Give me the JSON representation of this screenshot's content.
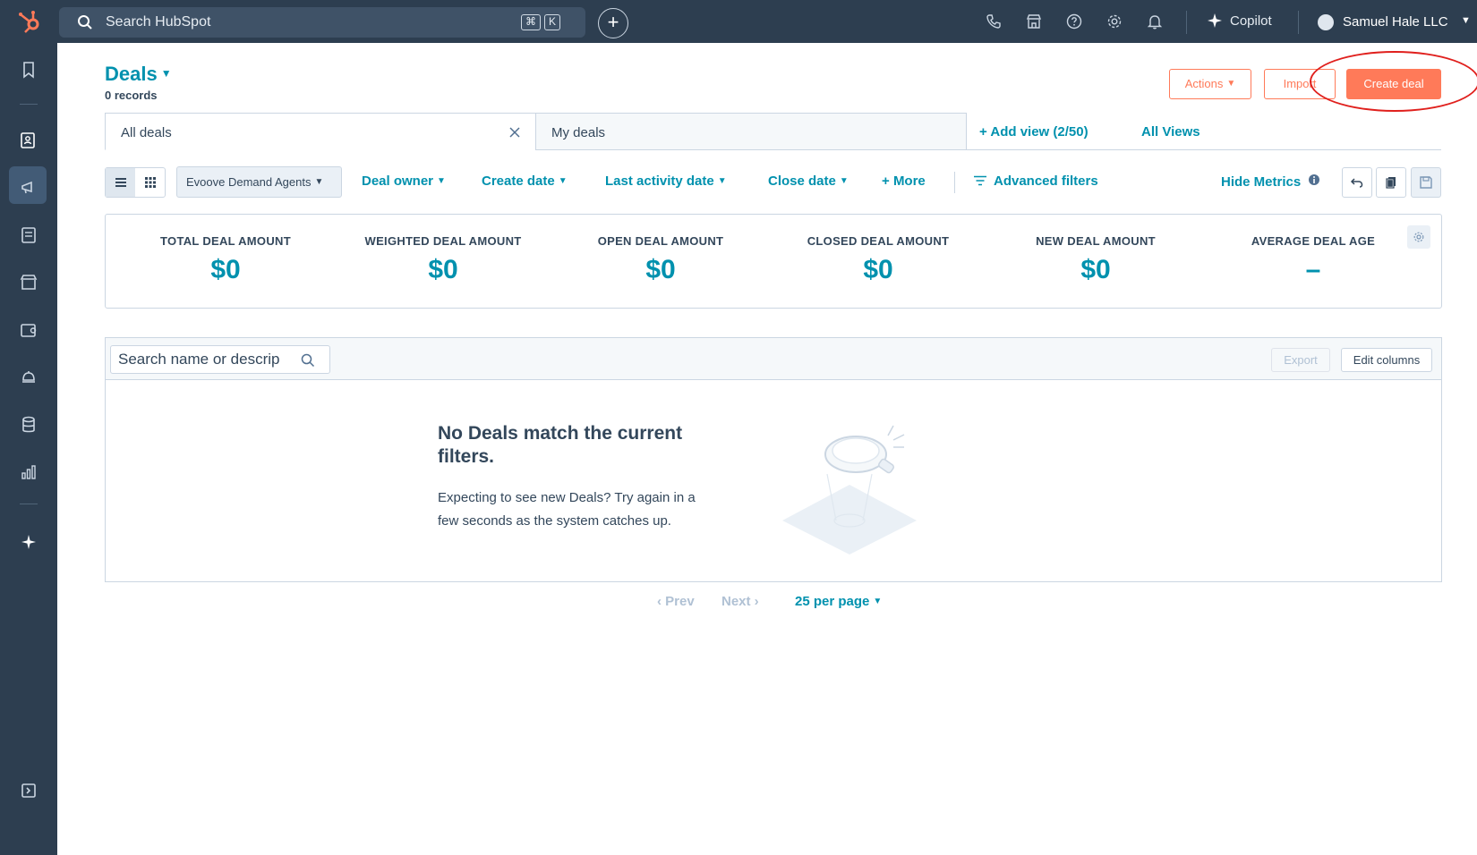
{
  "topbar": {
    "search_label": "Search HubSpot",
    "kbd_cmd": "⌘",
    "kbd_k": "K",
    "copilot_label": "Copilot",
    "account_name": "Samuel Hale LLC"
  },
  "header": {
    "title": "Deals",
    "records": "0 records",
    "actions_label": "Actions",
    "import_label": "Import",
    "create_label": "Create deal"
  },
  "tabs": {
    "all_deals": "All deals",
    "my_deals": "My deals",
    "add_view": "Add view (2/50)",
    "all_views": "All Views"
  },
  "filters": {
    "pipeline": "Evoove Demand Agents",
    "deal_owner": "Deal owner",
    "create_date": "Create date",
    "last_activity": "Last activity date",
    "close_date": "Close date",
    "more": "More",
    "advanced": "Advanced filters",
    "hide_metrics": "Hide Metrics"
  },
  "metrics": [
    {
      "label": "TOTAL DEAL AMOUNT",
      "value": "$0"
    },
    {
      "label": "WEIGHTED DEAL AMOUNT",
      "value": "$0"
    },
    {
      "label": "OPEN DEAL AMOUNT",
      "value": "$0"
    },
    {
      "label": "CLOSED DEAL AMOUNT",
      "value": "$0"
    },
    {
      "label": "NEW DEAL AMOUNT",
      "value": "$0"
    },
    {
      "label": "AVERAGE DEAL AGE",
      "value": "–"
    }
  ],
  "table": {
    "search_placeholder": "Search name or descrip",
    "export_label": "Export",
    "edit_columns_label": "Edit columns",
    "empty_title": "No Deals match the current filters.",
    "empty_text": "Expecting to see new Deals? Try again in a few seconds as the system catches up."
  },
  "pagination": {
    "prev": "Prev",
    "next": "Next",
    "per_page": "25 per page"
  },
  "colors": {
    "nav_bg": "#2d3e50",
    "link": "#0091ae",
    "accent": "#ff7a59",
    "annotation": "#e0201d"
  }
}
